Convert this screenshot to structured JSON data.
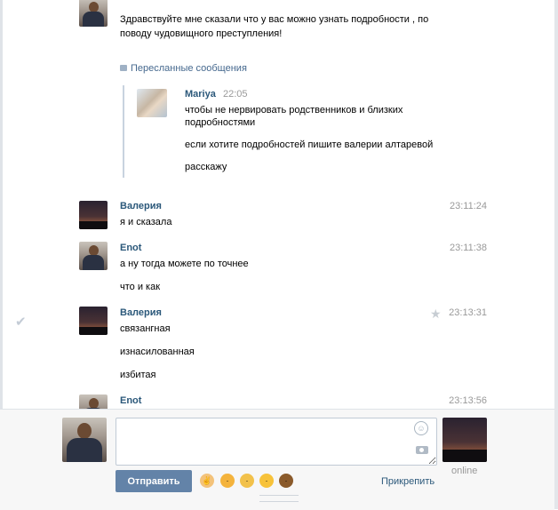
{
  "messages": {
    "top": {
      "lines": [
        "Здравствуйте мне сказали что у вас можно узнать подробности , по",
        "поводу чудовищного преступления!"
      ],
      "forwarded": {
        "header": "Пересланные сообщения",
        "author": "Mariya",
        "time": "22:05",
        "lines": [
          "чтобы не нервировать родственников и близких",
          "подробностями",
          "если хотите подробностей пишите валерии алтаревой",
          "расскажу"
        ]
      }
    },
    "m1": {
      "author": "Валерия",
      "time": "23:11:24",
      "lines": [
        "я и сказала"
      ]
    },
    "m2": {
      "author": "Enot",
      "time": "23:11:38",
      "lines": [
        "а ну тогда можете по точнее",
        "что и как"
      ]
    },
    "m3": {
      "author": "Валерия",
      "time": "23:13:31",
      "lines": [
        "связангная",
        "изнасилованная",
        "избитая"
      ]
    },
    "m4": {
      "author": "Enot",
      "time": "23:13:56"
    }
  },
  "composer": {
    "send_label": "Отправить",
    "attach_label": "Прикрепить",
    "peer_status": "online",
    "emoji": [
      "victory-hand",
      "angry-face",
      "fearful-face",
      "grinning-face",
      "pile-of-poo"
    ],
    "placeholder": ""
  },
  "colors": {
    "accent": "#6383a8",
    "link": "#2b587a",
    "time": "#999999"
  }
}
